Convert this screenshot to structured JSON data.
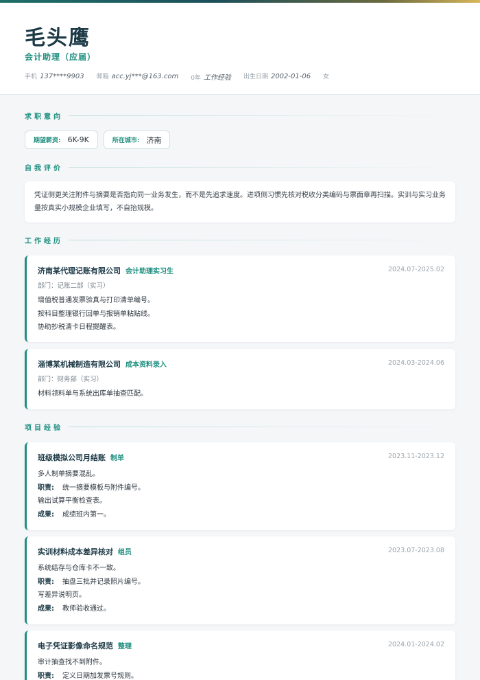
{
  "header": {
    "name": "毛头鹰",
    "role": "会计助理（应届）",
    "meta": [
      {
        "label": "手机",
        "value": "137****9903"
      },
      {
        "label": "邮箱",
        "value": "acc.yj***@163.com"
      },
      {
        "label": "0年",
        "value": "工作经验"
      },
      {
        "label": "出生日期",
        "value": "2002-01-06"
      },
      {
        "label": "",
        "value": "女"
      }
    ]
  },
  "sections": {
    "intent": "求职意向",
    "evaluation": "自我评价",
    "work": "工作经历",
    "projects": "项目经验"
  },
  "intent": {
    "salary_label": "期望薪资:",
    "salary": "6K-9K",
    "city_label": "所在城市:",
    "city": "济南"
  },
  "evaluation": {
    "text": "凭证侧更关注附件与摘要是否指向同一业务发生，而不是先追求速度。进项侧习惯先核对税收分类编码与票面章再扫描。实训与实习业务量按真实小规模企业填写，不自抬规模。"
  },
  "work": [
    {
      "company": "济南某代理记账有限公司",
      "position": "会计助理实习生",
      "date": "2024.07-2025.02",
      "dept": "部门：记账二部（实习）",
      "lines": [
        "增值税普通发票验真与打印清单编号。",
        "按科目整理银行回单与报销单粘贴线。",
        "协助抄税清卡日程提醒表。"
      ]
    },
    {
      "company": "淄博某机械制造有限公司",
      "position": "成本资料录入",
      "date": "2024.03-2024.06",
      "dept": "部门：财务部（实习）",
      "lines": [
        "材料领料单与系统出库单抽查匹配。"
      ]
    }
  ],
  "projects": [
    {
      "name": "班级模拟公司月结账",
      "role": "制单",
      "date": "2023.11-2023.12",
      "desc": "多人制单摘要混乱。",
      "duty_label": "职责:",
      "duty": "统一摘要模板与附件编号。",
      "duty2": "输出试算平衡检查表。",
      "result_label": "成果:",
      "result": "成绩班内第一。"
    },
    {
      "name": "实训材料成本差异核对",
      "role": "组员",
      "date": "2023.07-2023.08",
      "desc": "系统结存与仓库卡不一致。",
      "duty_label": "职责:",
      "duty": "抽盘三批并记录照片编号。",
      "duty2": "写差异说明页。",
      "result_label": "成果:",
      "result": "教师验收通过。"
    },
    {
      "name": "电子凭证影像命名规范",
      "role": "整理",
      "date": "2024.01-2024.02",
      "desc": "审计抽查找不到附件。",
      "duty_label": "职责:",
      "duty": "定义日期加发票号规则。"
    }
  ],
  "colors": {
    "accent": "#1f8f80",
    "title": "#1d3a47",
    "background": "#f4f6f8"
  }
}
